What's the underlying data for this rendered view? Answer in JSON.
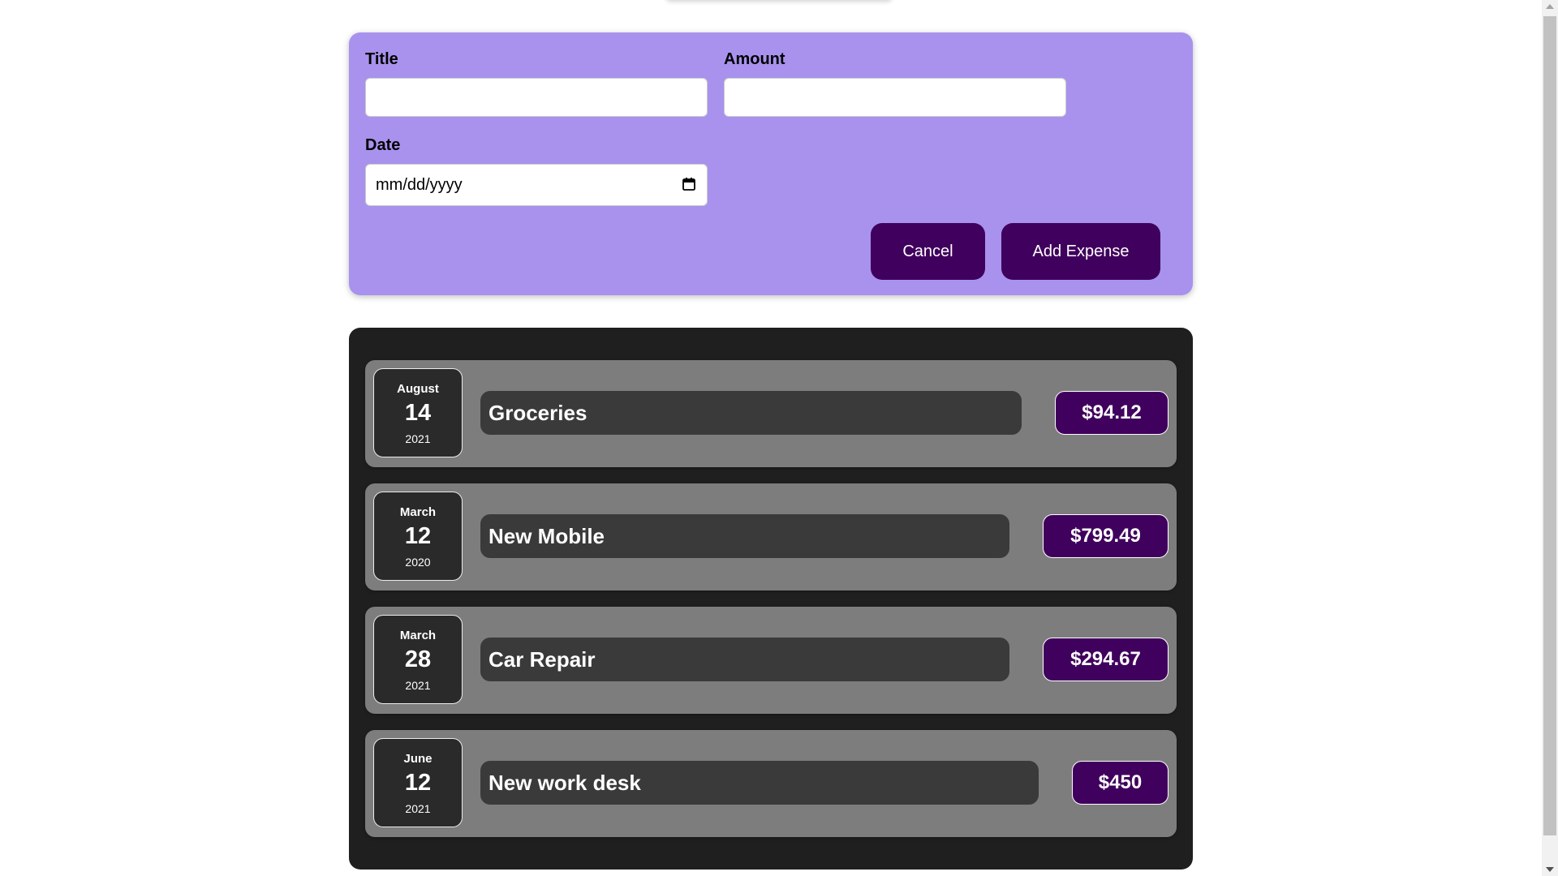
{
  "form": {
    "title_label": "Title",
    "title_value": "",
    "amount_label": "Amount",
    "amount_value": "",
    "date_label": "Date",
    "date_placeholder": "mm/dd/yyyy",
    "cancel_label": "Cancel",
    "add_label": "Add Expense"
  },
  "expenses": [
    {
      "month": "August",
      "day": "14",
      "year": "2021",
      "title": "Groceries",
      "amount": "$94.12"
    },
    {
      "month": "March",
      "day": "12",
      "year": "2020",
      "title": "New Mobile",
      "amount": "$799.49"
    },
    {
      "month": "March",
      "day": "28",
      "year": "2021",
      "title": "Car Repair",
      "amount": "$294.67"
    },
    {
      "month": "June",
      "day": "12",
      "year": "2021",
      "title": "New work desk",
      "amount": "$450"
    }
  ],
  "colors": {
    "form_bg": "#a892ee",
    "button_bg": "#40005d",
    "list_bg": "#1f1f1f",
    "item_bg": "#7d7d7d",
    "title_pill_bg": "#3a3a3a"
  },
  "icons": {
    "date_picker": "calendar-icon"
  }
}
